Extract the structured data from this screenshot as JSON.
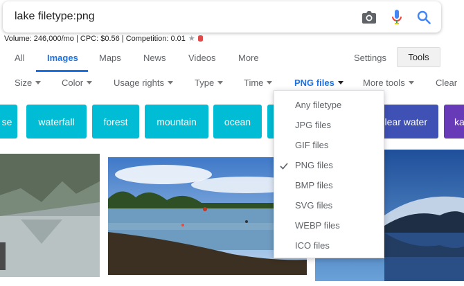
{
  "search": {
    "query": "lake filetype:png"
  },
  "seo": {
    "text": "Volume: 246,000/mo | CPC: $0.56 | Competition: 0.01",
    "star": "★"
  },
  "tabs": {
    "all": "All",
    "images": "Images",
    "maps": "Maps",
    "news": "News",
    "videos": "Videos",
    "more": "More",
    "settings": "Settings",
    "tools": "Tools"
  },
  "filters": {
    "size": "Size",
    "color": "Color",
    "usage": "Usage rights",
    "type": "Type",
    "time": "Time",
    "png": "PNG files",
    "more_tools": "More tools",
    "clear": "Clear"
  },
  "chips": {
    "c0": "se",
    "c1": "waterfall",
    "c2": "forest",
    "c3": "mountain",
    "c4": "ocean",
    "c5": "clear water",
    "c6": "ka"
  },
  "dropdown": {
    "items": [
      "Any filetype",
      "JPG files",
      "GIF files",
      "PNG files",
      "BMP files",
      "SVG files",
      "WEBP files",
      "ICO files"
    ],
    "selected": "PNG files"
  },
  "colors": {
    "accent": "#1a73e8",
    "chip": "#00bcd4",
    "chip_indigo": "#3f51b5",
    "chip_purple": "#673ab7"
  },
  "icons": [
    "camera-icon",
    "mic-icon",
    "search-icon",
    "star-icon",
    "database-icon",
    "checkmark-icon",
    "caret-down-icon"
  ]
}
